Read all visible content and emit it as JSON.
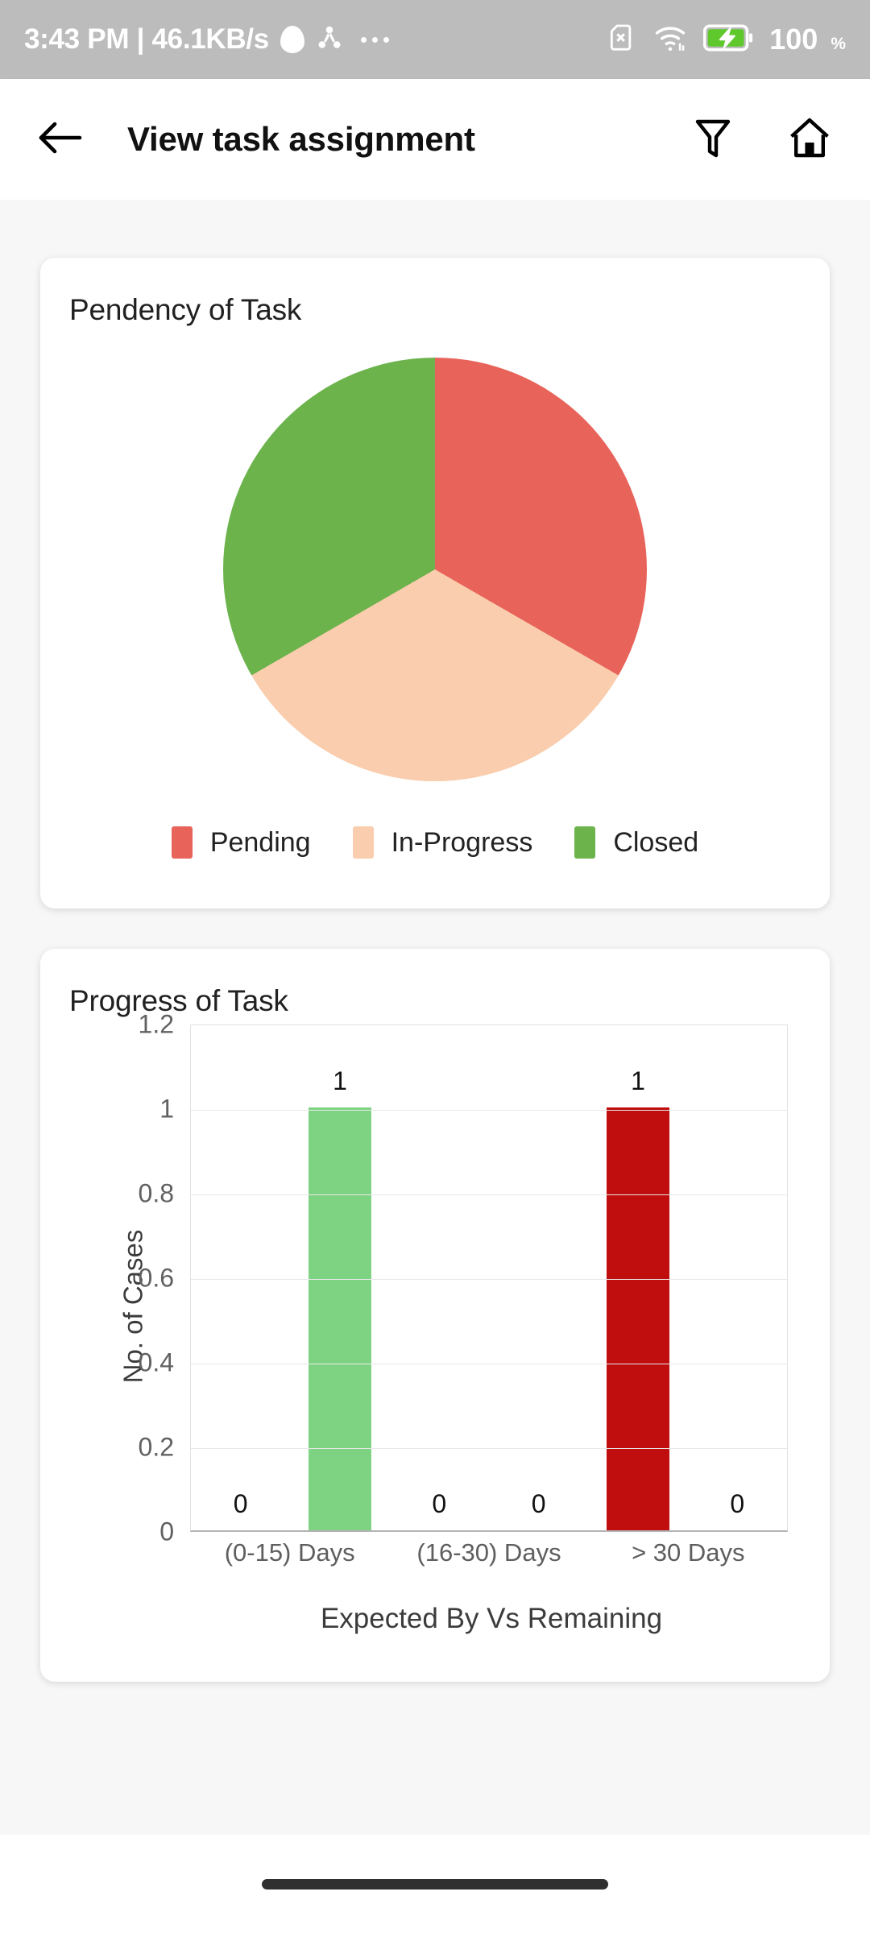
{
  "statusbar": {
    "clock": "3:43 PM | 46.1KB/s",
    "icons": [
      "recording-blob-icon",
      "share-nodes-icon",
      "overflow-dots-icon",
      "sim-card-off-icon",
      "wifi-icon",
      "battery-charging-icon"
    ],
    "battery_percent": "100",
    "percent_sign": "%"
  },
  "appbar": {
    "back_icon": "arrow-back-icon",
    "title": "View task assignment",
    "filter_icon": "filter-funnel-icon",
    "home_icon": "home-icon"
  },
  "cards": {
    "pendency": {
      "title": "Pendency of Task"
    },
    "progress": {
      "title": "Progress of Task"
    }
  },
  "colors": {
    "pending": "#e8635a",
    "in_progress": "#f9cdad",
    "closed": "#6cb34c",
    "expected_by": "#7ed382",
    "remaining": "#c00d0d",
    "status_bar": "#bcbcbc",
    "page_background": "#f7f7f7",
    "card_background": "#ffffff"
  },
  "chart_data": [
    {
      "type": "pie",
      "title": "Pendency of Task",
      "legend_position": "bottom",
      "categories": [
        "Pending",
        "In-Progress",
        "Closed"
      ],
      "values": [
        1,
        1,
        1
      ],
      "percentages": [
        33.33,
        33.33,
        33.33
      ],
      "colors": [
        "#e8635a",
        "#f9cdad",
        "#6cb34c"
      ],
      "start_angle": 0
    },
    {
      "type": "bar",
      "title": "Progress of Task",
      "xlabel": "Expected By Vs Remaining",
      "ylabel": "No. of Cases",
      "categories": [
        "(0-15) Days",
        "(16-30) Days",
        "> 30 Days"
      ],
      "series": [
        {
          "name": "Expected By",
          "color": "#7ed382",
          "values": [
            1,
            0,
            0
          ]
        },
        {
          "name": "Remaining",
          "color": "#c00d0d",
          "values": [
            0,
            0,
            1
          ]
        }
      ],
      "bar_slots": [
        {
          "value": 0,
          "color": "#7ed382",
          "show_bar": false,
          "label": "0"
        },
        {
          "value": 1,
          "color": "#7ed382",
          "show_bar": true,
          "label": "1"
        },
        {
          "value": 0,
          "color": "#c00d0d",
          "show_bar": false,
          "label": "0"
        },
        {
          "value": 0,
          "color": "#7ed382",
          "show_bar": false,
          "label": "0"
        },
        {
          "value": 1,
          "color": "#c00d0d",
          "show_bar": true,
          "label": "1"
        },
        {
          "value": 0,
          "color": "#c00d0d",
          "show_bar": false,
          "label": "0"
        }
      ],
      "ylim": [
        0,
        1.2
      ],
      "yticks": [
        "0",
        "0.2",
        "0.4",
        "0.6",
        "0.8",
        "1",
        "1.2"
      ],
      "ytick_values": [
        0,
        0.2,
        0.4,
        0.6,
        0.8,
        1,
        1.2
      ],
      "grid": true
    }
  ]
}
